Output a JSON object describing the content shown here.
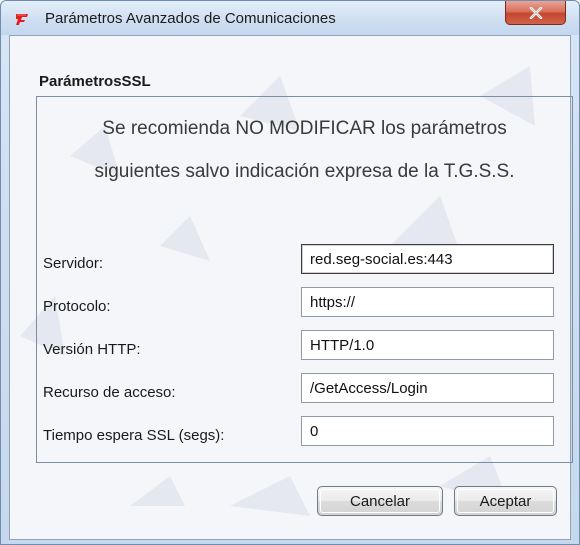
{
  "window": {
    "title": "Parámetros Avanzados de Comunicaciones",
    "close_glyph": "x",
    "app_icon": "app-logo-icon"
  },
  "section": {
    "title": "ParámetrosSSL",
    "notice_line1": "Se recomienda NO MODIFICAR los parámetros",
    "notice_line2": "siguientes salvo indicación expresa de la T.G.S.S."
  },
  "fields": [
    {
      "label": "Servidor:",
      "value": "red.seg-social.es:443"
    },
    {
      "label": "Protocolo:",
      "value": "https://"
    },
    {
      "label": "Versión HTTP:",
      "value": "HTTP/1.0"
    },
    {
      "label": "Recurso de acceso:",
      "value": "/GetAccess/Login"
    },
    {
      "label": "Tiempo espera SSL (segs):",
      "value": "0"
    }
  ],
  "buttons": {
    "cancel": "Cancelar",
    "accept": "Aceptar"
  },
  "colors": {
    "close_button": "#c4462d",
    "app_icon_red": "#e02020",
    "title_bar": "#cfdff1"
  }
}
